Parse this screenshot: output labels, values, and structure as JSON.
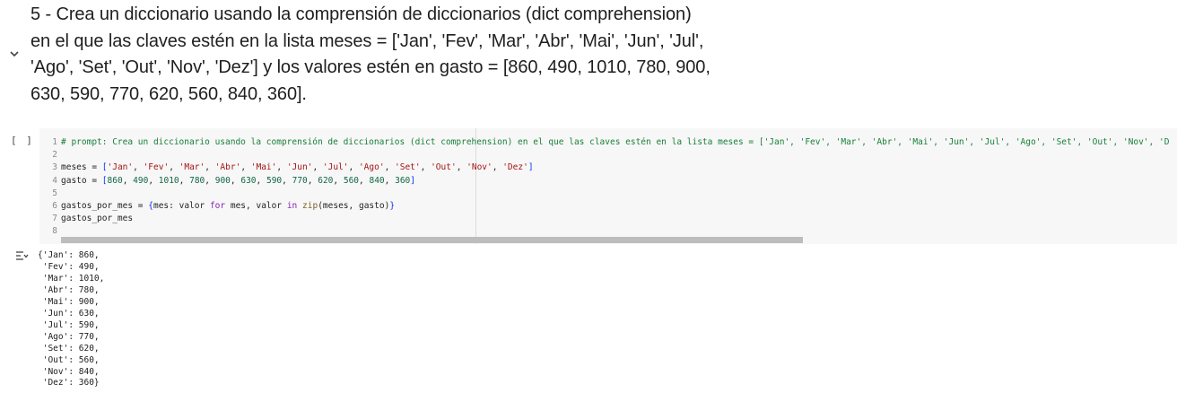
{
  "markdown_cell": {
    "lines": [
      "5 - Crea un diccionario usando la comprensión de diccionarios (dict comprehension)",
      "en el que las claves estén en la lista meses = ['Jan', 'Fev', 'Mar', 'Abr', 'Mai', 'Jun', 'Jul',",
      "'Ago', 'Set', 'Out', 'Nov', 'Dez'] y los valores estén en gasto = [860, 490, 1010, 780, 900,",
      "630, 590, 770, 620, 560, 840, 360]."
    ]
  },
  "code_cell": {
    "run_label": "[ ]",
    "line_numbers": [
      "1",
      "2",
      "3",
      "4",
      "5",
      "6",
      "7",
      "8"
    ],
    "comment": "# prompt: Crea un diccionario usando la comprensión de diccionarios (dict comprehension) en el que las claves estén en la lista meses = ['Jan', 'Fev', 'Mar', 'Abr', 'Mai', 'Jun', 'Jul', 'Ago', 'Set', 'Out', 'Nov', 'D",
    "meses_name": "meses",
    "meses_values": [
      "Jan",
      "Fev",
      "Mar",
      "Abr",
      "Mai",
      "Jun",
      "Jul",
      "Ago",
      "Set",
      "Out",
      "Nov",
      "Dez"
    ],
    "gasto_name": "gasto",
    "gasto_values": [
      860,
      490,
      1010,
      780,
      900,
      630,
      590,
      770,
      620,
      560,
      840,
      360
    ],
    "dict_var": "gastos_por_mes",
    "comp_key": "mes",
    "comp_value": "valor",
    "kw_for": "for",
    "kw_in": "in",
    "fn_zip": "zip"
  },
  "output": {
    "icon": "output-toggle-icon",
    "lines": [
      "{'Jan': 860,",
      " 'Fev': 490,",
      " 'Mar': 1010,",
      " 'Abr': 780,",
      " 'Mai': 900,",
      " 'Jun': 630,",
      " 'Jul': 590,",
      " 'Ago': 770,",
      " 'Set': 620,",
      " 'Out': 560,",
      " 'Nov': 840,",
      " 'Dez': 360}"
    ]
  },
  "colors": {
    "comment": "#188038",
    "string": "#a31515",
    "number": "#116644",
    "keyword": "#8b22b5",
    "function": "#795e26",
    "editor_bg": "#f7f7f7"
  }
}
